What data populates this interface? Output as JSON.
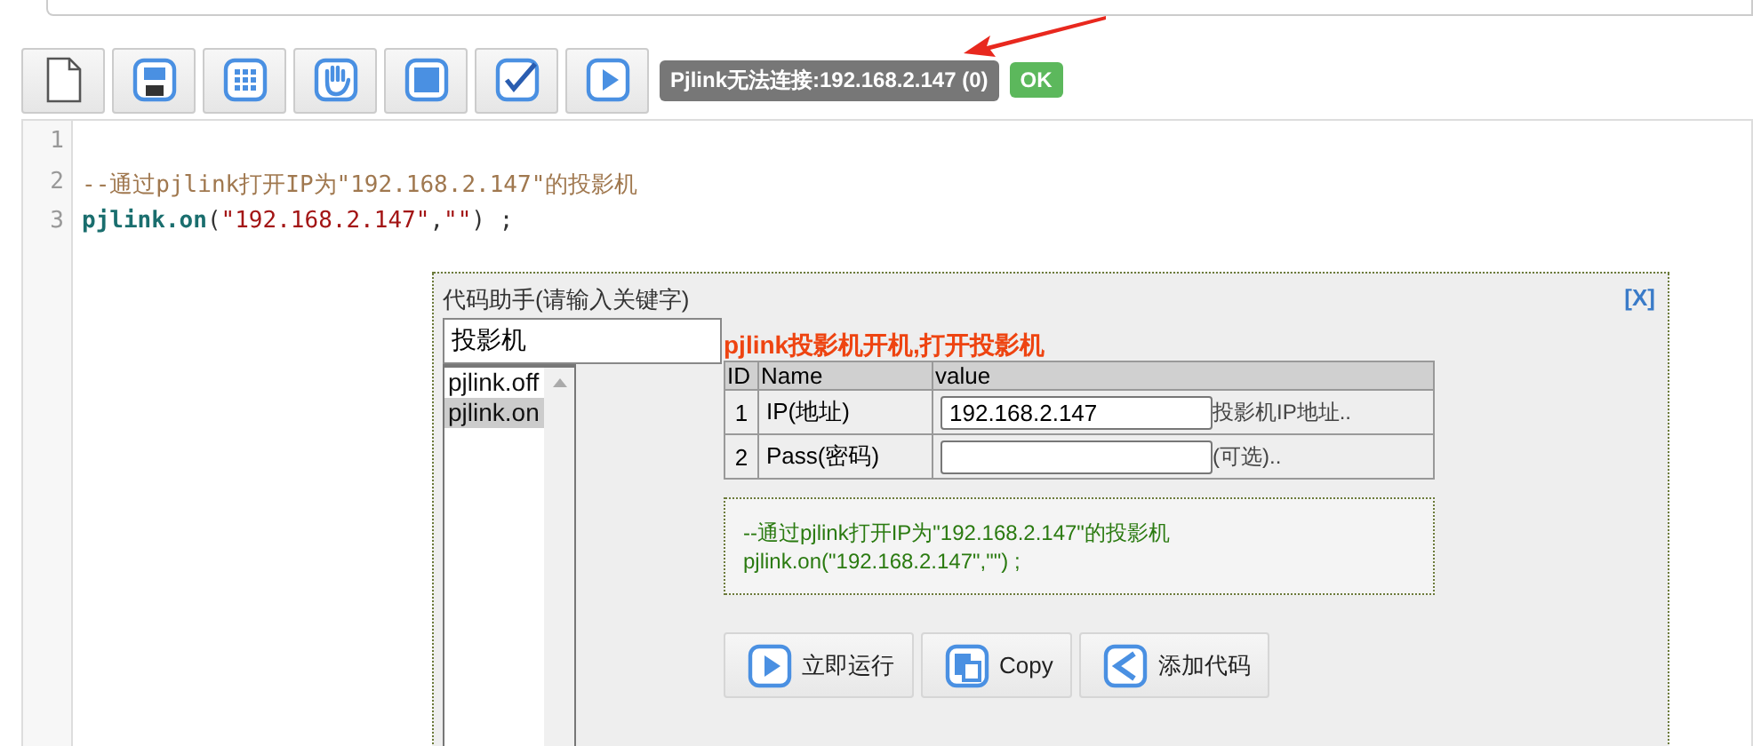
{
  "toolbar": {
    "buttons": [
      {
        "kind": "file"
      },
      {
        "kind": "save"
      },
      {
        "kind": "grid"
      },
      {
        "kind": "hand"
      },
      {
        "kind": "stop"
      },
      {
        "kind": "check"
      },
      {
        "kind": "play"
      }
    ],
    "status": "Pjlink无法连接:192.168.2.147 (0)",
    "ok": "OK"
  },
  "editor": {
    "lines": [
      {
        "number": "1"
      },
      {
        "number": "2",
        "tokens": [
          {
            "kind": "comment",
            "text": "--通过pjlink打开IP为\"192.168.2.147\"的投影机"
          }
        ]
      },
      {
        "number": "3",
        "tokens": [
          {
            "kind": "ident",
            "text": "pjlink.on"
          },
          {
            "kind": "punct",
            "text": "("
          },
          {
            "kind": "string",
            "text": "\"192.168.2.147\""
          },
          {
            "kind": "punct",
            "text": ","
          },
          {
            "kind": "string",
            "text": "\"\""
          },
          {
            "kind": "punct",
            "text": ") ;"
          }
        ]
      }
    ]
  },
  "dialog": {
    "title": "代码助手(请输入关键字)",
    "close": "[X]",
    "search": {
      "value": "投影机"
    },
    "items": [
      {
        "label": "pjlink.off",
        "selected": false
      },
      {
        "label": "pjlink.on",
        "selected": true
      }
    ],
    "help_title": "pjlink投影机开机,打开投影机",
    "columns": [
      "ID",
      "Name",
      "value"
    ],
    "rows": [
      {
        "id": "1",
        "name": "IP(地址)",
        "value": "192.168.2.147",
        "hint": "投影机IP地址.."
      },
      {
        "id": "2",
        "name": "Pass(密码)",
        "value": "",
        "hint": "(可选).."
      }
    ],
    "preview": [
      "--通过pjlink打开IP为\"192.168.2.147\"的投影机",
      "pjlink.on(\"192.168.2.147\",\"\") ;"
    ],
    "buttons": [
      {
        "kind": "play",
        "label": "立即运行"
      },
      {
        "kind": "copy",
        "label": "Copy"
      },
      {
        "kind": "back",
        "label": "添加代码"
      }
    ]
  }
}
